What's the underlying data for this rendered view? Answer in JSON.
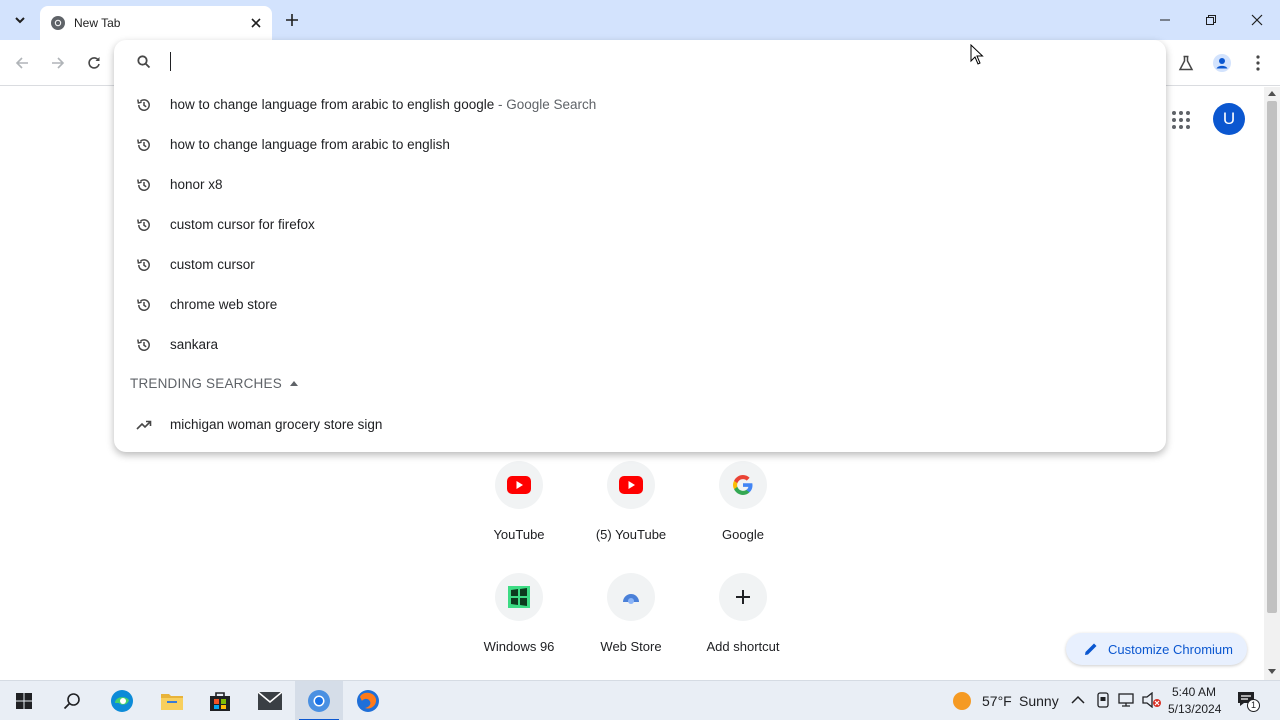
{
  "browser": {
    "tab": {
      "title": "New Tab"
    },
    "colors": {
      "tabstrip": "#d3e3fd",
      "accent": "#0b57d0"
    }
  },
  "omnibox": {
    "value": "",
    "placeholder": "",
    "suggestions": [
      {
        "text": "how to change language from arabic to english google",
        "suffix": " - Google Search",
        "icon": "history-icon"
      },
      {
        "text": "how to change language from arabic to english",
        "suffix": "",
        "icon": "history-icon"
      },
      {
        "text": "honor x8",
        "suffix": "",
        "icon": "history-icon"
      },
      {
        "text": "custom cursor for firefox",
        "suffix": "",
        "icon": "history-icon"
      },
      {
        "text": "custom cursor",
        "suffix": "",
        "icon": "history-icon"
      },
      {
        "text": "chrome web store",
        "suffix": "",
        "icon": "history-icon"
      },
      {
        "text": "sankara",
        "suffix": "",
        "icon": "history-icon"
      }
    ],
    "trending_header": "TRENDING SEARCHES",
    "trending": [
      {
        "text": "michigan woman grocery store sign",
        "icon": "trending-icon"
      }
    ]
  },
  "ntp": {
    "avatar_letter": "U",
    "shortcuts": [
      {
        "label": "YouTube",
        "icon": "youtube-icon"
      },
      {
        "label": "(5) YouTube",
        "icon": "youtube-icon"
      },
      {
        "label": "Google",
        "icon": "google-icon"
      },
      {
        "label": "Windows 96",
        "icon": "windows96-icon"
      },
      {
        "label": "Web Store",
        "icon": "webstore-icon"
      },
      {
        "label": "Add shortcut",
        "icon": "plus-icon"
      }
    ],
    "customize_label": "Customize Chromium"
  },
  "taskbar": {
    "weather_temp": "57°F",
    "weather_cond": "Sunny",
    "time": "5:40 AM",
    "date": "5/13/2024",
    "notification_count": "1"
  }
}
